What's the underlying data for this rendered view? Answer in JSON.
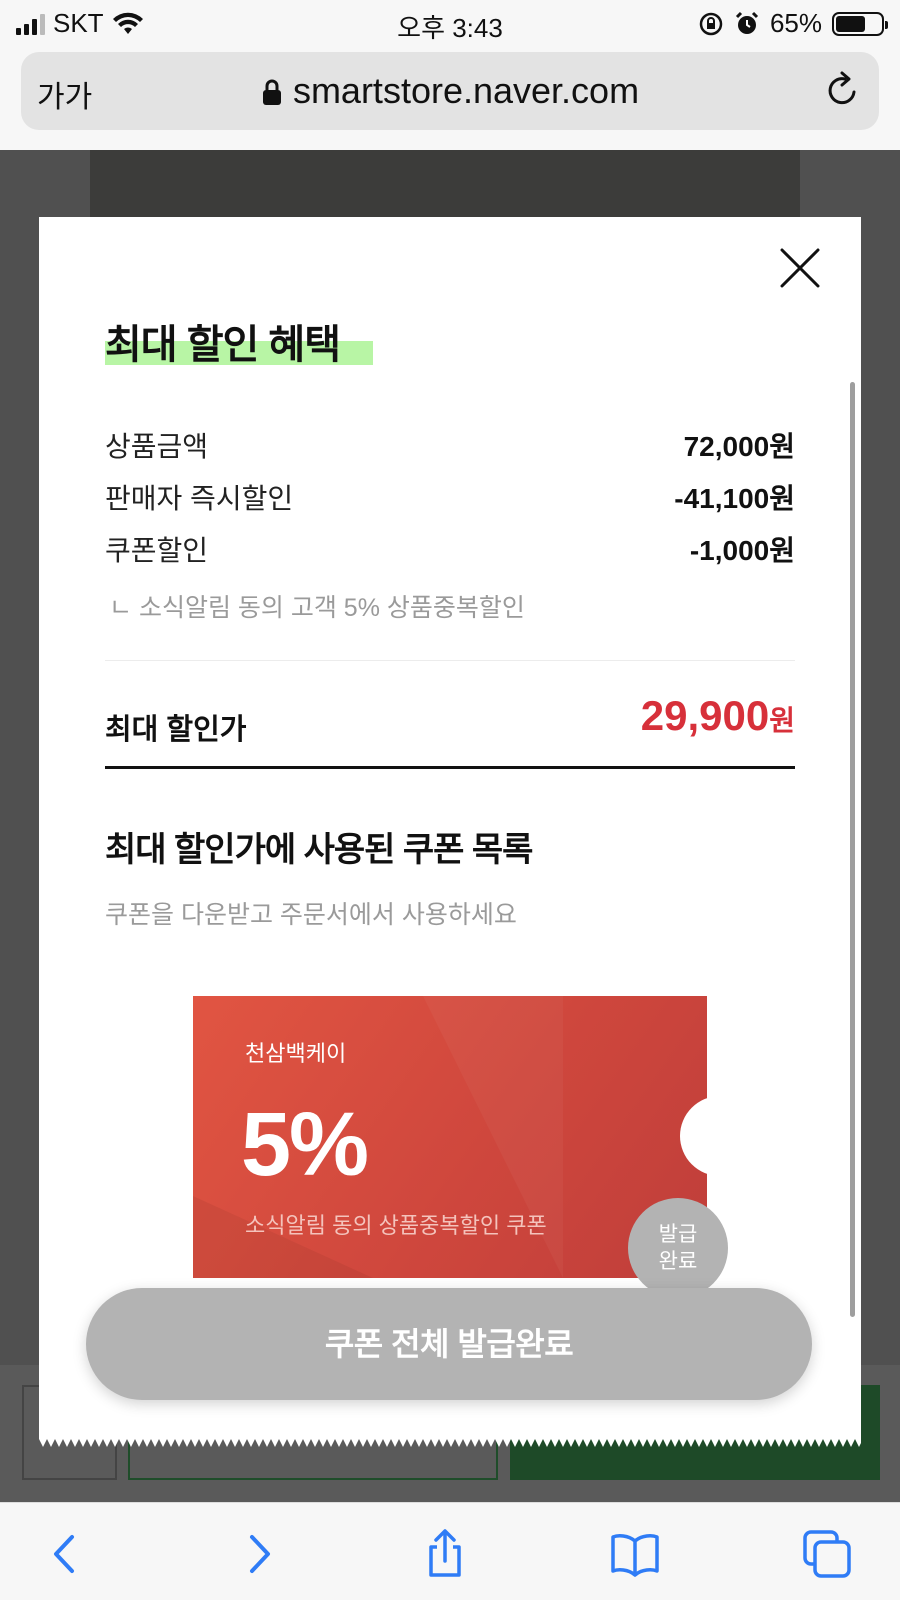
{
  "status_bar": {
    "carrier": "SKT",
    "time": "오후 3:43",
    "battery": "65%",
    "battery_level": 0.65
  },
  "address_bar": {
    "text_size_label": "가가",
    "url": "smartstore.naver.com"
  },
  "modal": {
    "title": "최대 할인 혜택",
    "rows": [
      {
        "label": "상품금액",
        "value": "72,000원"
      },
      {
        "label": "판매자 즉시할인",
        "value": "-41,100원"
      },
      {
        "label": "쿠폰할인",
        "value": "-1,000원"
      }
    ],
    "sub_note": "ㄴ 소식알림 동의 고객 5% 상품중복할인",
    "final": {
      "label": "최대 할인가",
      "amount": "29,900",
      "unit": "원"
    },
    "coupon_section_title": "최대 할인가에 사용된 쿠폰 목록",
    "coupon_section_sub": "쿠폰을 다운받고 주문서에서 사용하세요",
    "coupon": {
      "store": "천삼백케이",
      "rate": "5%",
      "description": "소식알림 동의 상품중복할인 쿠폰",
      "badge_line1": "발급",
      "badge_line2": "완료"
    },
    "button_label": "쿠폰 전체 발급완료"
  },
  "colors": {
    "accent_red": "#d7303a",
    "coupon_red": "#d24a3f",
    "highlight_green": "#b8f5a5",
    "disabled_gray": "#b3b3b3",
    "link_blue": "#2f7cf6"
  }
}
